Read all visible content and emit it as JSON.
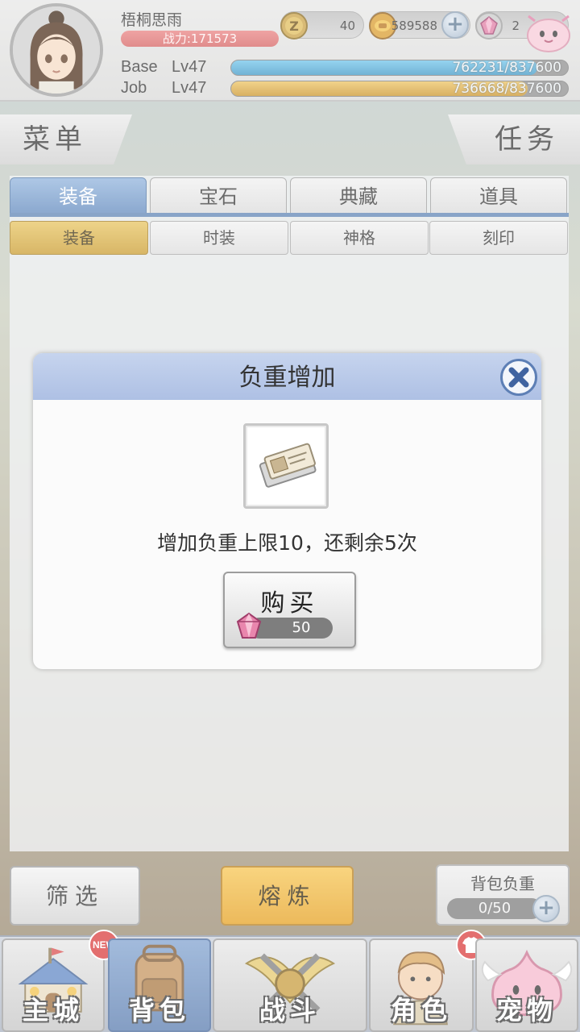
{
  "player": {
    "name": "梧桐思雨",
    "power_text": "战力:171573"
  },
  "currencies": [
    {
      "name": "zeny",
      "icon": "coin-z-icon",
      "value": "40"
    },
    {
      "name": "gold",
      "icon": "gold-coin-icon",
      "value": "589588"
    },
    {
      "name": "gem",
      "icon": "gem-icon",
      "value": "2"
    }
  ],
  "levels": {
    "base_label": "Base",
    "base_level": "Lv47",
    "base_exp": "762231/837600",
    "base_progress": 0.91,
    "job_label": "Job",
    "job_level": "Lv47",
    "job_exp": "736668/837600",
    "job_progress": 0.88
  },
  "header": {
    "menu_label": "菜单",
    "task_label": "任务"
  },
  "tabs": [
    {
      "label": "装备",
      "active": true
    },
    {
      "label": "宝石",
      "active": false
    },
    {
      "label": "典藏",
      "active": false
    },
    {
      "label": "道具",
      "active": false
    }
  ],
  "subtabs": [
    {
      "label": "装备",
      "active": true
    },
    {
      "label": "时装",
      "active": false
    },
    {
      "label": "神格",
      "active": false
    },
    {
      "label": "刻印",
      "active": false
    }
  ],
  "dialog": {
    "title": "负重增加",
    "description": "增加负重上限10，还剩余5次",
    "buy_label": "购买",
    "price": "50",
    "item_icon": "ticket-icon"
  },
  "controls": {
    "filter_label": "筛选",
    "smelt_label": "熔炼",
    "weight_title": "背包负重",
    "weight_value": "0/50"
  },
  "nav": [
    {
      "label": "主城",
      "icon": "castle-icon",
      "active": false
    },
    {
      "label": "背包",
      "icon": "backpack-icon",
      "active": true
    },
    {
      "label": "战斗",
      "icon": "crossed-swords-icon",
      "active": false
    },
    {
      "label": "角色",
      "icon": "character-icon",
      "active": false
    },
    {
      "label": "宠物",
      "icon": "poring-pet-icon",
      "active": false
    }
  ],
  "badges": {
    "new_text": "NEW"
  },
  "colors": {
    "accent_blue": "#5e87bc",
    "accent_gold": "#e59f1d",
    "power_red": "#d46060",
    "base_exp": "#4aa7d6",
    "job_exp": "#d6a73c"
  }
}
